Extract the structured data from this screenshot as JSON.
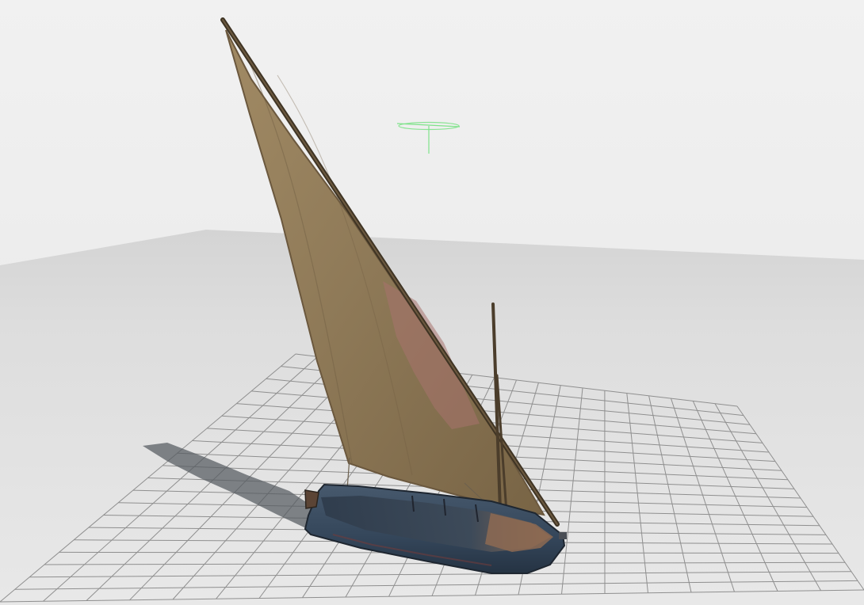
{
  "viewport": {
    "kind": "3d-model-viewer",
    "background_color": "#ececec",
    "floor_color": "#dcdcdc",
    "grid_color": "#8f8f8f",
    "grid_visible": true
  },
  "scene": {
    "model": "sailboat",
    "sail_color": "#8f7a58",
    "sail_patch_color": "#a8726d",
    "hull_color": "#34465a",
    "deck_color": "#7b5b45",
    "mast_color": "#3f3424",
    "shadow_visible": true
  },
  "gizmo": {
    "icon": "transform-gizmo-icon",
    "color": "#7ee28a"
  }
}
